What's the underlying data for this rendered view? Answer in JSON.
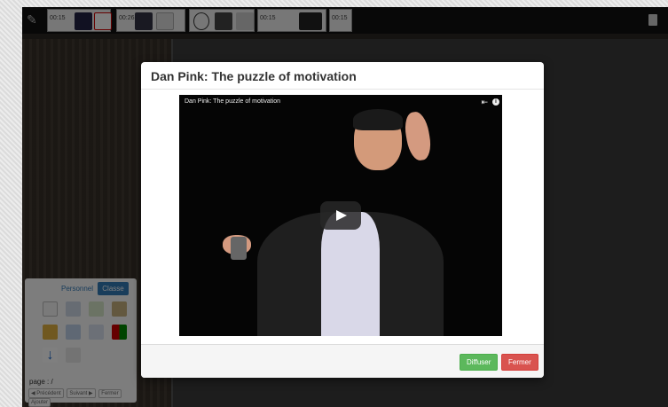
{
  "topbar": {
    "slots": [
      {
        "time": "00:15"
      },
      {
        "time": "00:26"
      },
      {
        "time": "00:15"
      },
      {
        "time": "00:15"
      }
    ]
  },
  "tools": {
    "tab_personnel": "Personnel",
    "tab_classe": "Classe",
    "page_label": "page : /",
    "nav": {
      "prev": "◀ Précédent",
      "next": "Suivant ▶",
      "close": "Fermer",
      "add": "Ajouter"
    }
  },
  "modal": {
    "title": "Dan Pink: The puzzle of motivation",
    "video_title": "Dan Pink: The puzzle of motivation",
    "buttons": {
      "broadcast": "Diffuser",
      "close": "Fermer"
    }
  },
  "colors": {
    "accent_blue": "#337ab7",
    "green": "#5cb85c",
    "red": "#d9534f"
  }
}
